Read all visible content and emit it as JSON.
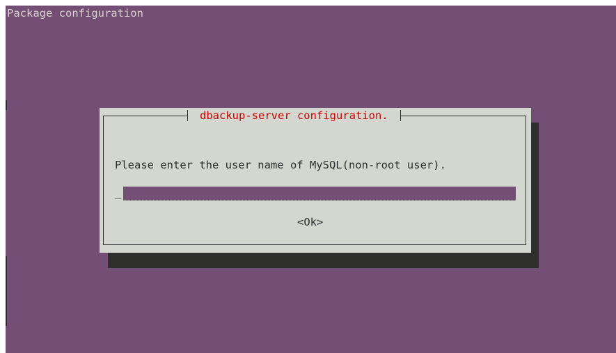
{
  "screen": {
    "title": "Package configuration"
  },
  "dialog": {
    "title": "dbackup-server configuration.",
    "prompt": "Please enter the user name of MySQL(non-root user).",
    "input": {
      "value": "",
      "cursor": "_"
    },
    "ok_label": "<Ok>"
  },
  "colors": {
    "terminal_background": "#734f75",
    "dialog_background": "#d3d7cf",
    "dialog_title": "#cc0000",
    "shadow": "#2f302e",
    "screen_title_text": "#d9d2cc"
  }
}
